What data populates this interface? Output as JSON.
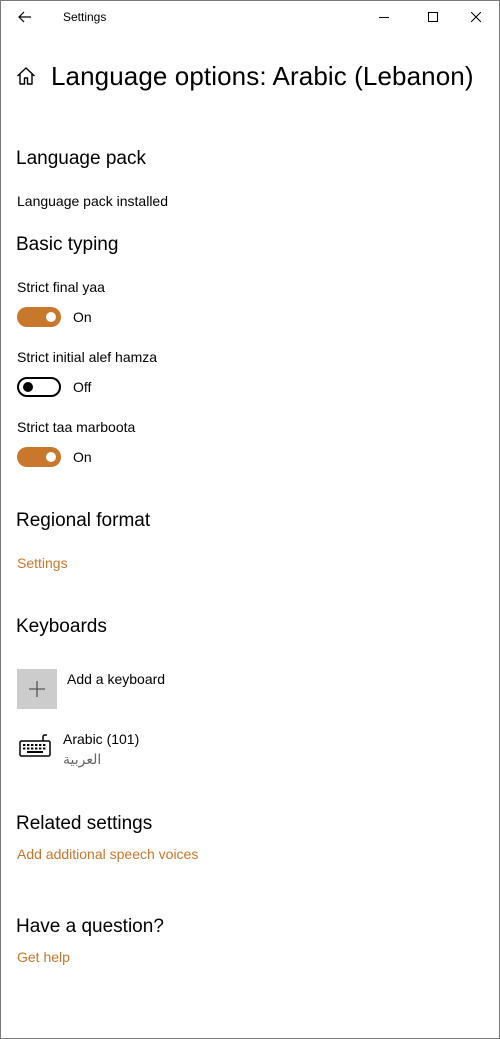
{
  "app": {
    "title": "Settings"
  },
  "window": {
    "back_icon": "back-arrow-icon",
    "minimize_icon": "minimize-icon",
    "maximize_icon": "maximize-icon",
    "close_icon": "close-icon"
  },
  "header": {
    "icon": "home-icon",
    "title": "Language options: Arabic (Lebanon)"
  },
  "language_pack": {
    "heading": "Language pack",
    "status": "Language pack installed"
  },
  "basic_typing": {
    "heading": "Basic typing",
    "options": [
      {
        "label": "Strict final yaa",
        "state": "On",
        "on": true
      },
      {
        "label": "Strict initial alef hamza",
        "state": "Off",
        "on": false
      },
      {
        "label": "Strict taa marboota",
        "state": "On",
        "on": true
      }
    ]
  },
  "regional_format": {
    "heading": "Regional format",
    "link": "Settings"
  },
  "keyboards": {
    "heading": "Keyboards",
    "add_label": "Add a keyboard",
    "items": [
      {
        "name": "Arabic (101)",
        "native": "العربية",
        "icon": "keyboard-icon"
      }
    ]
  },
  "related": {
    "heading": "Related settings",
    "link": "Add additional speech voices"
  },
  "help": {
    "heading": "Have a question?",
    "link": "Get help"
  },
  "colors": {
    "accent": "#c8772b",
    "tile": "#cccccc"
  }
}
